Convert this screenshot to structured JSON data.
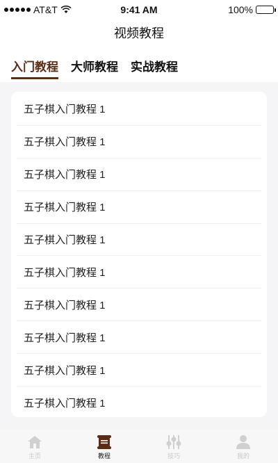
{
  "status_bar": {
    "carrier": "AT&T",
    "time": "9:41 AM",
    "battery": "100%"
  },
  "nav": {
    "title": "视频教程"
  },
  "tabs": [
    {
      "label": "入门教程",
      "active": true
    },
    {
      "label": "大师教程",
      "active": false
    },
    {
      "label": "实战教程",
      "active": false
    }
  ],
  "list": {
    "items": [
      "五子棋入门教程 1",
      "五子棋入门教程 1",
      "五子棋入门教程 1",
      "五子棋入门教程 1",
      "五子棋入门教程 1",
      "五子棋入门教程 1",
      "五子棋入门教程 1",
      "五子棋入门教程 1",
      "五子棋入门教程 1",
      "五子棋入门教程 1"
    ]
  },
  "tab_bar": {
    "items": [
      {
        "label": "主页",
        "icon": "home-icon",
        "active": false
      },
      {
        "label": "教程",
        "icon": "scroll-icon",
        "active": true
      },
      {
        "label": "技巧",
        "icon": "sliders-icon",
        "active": false
      },
      {
        "label": "我的",
        "icon": "user-icon",
        "active": false
      }
    ]
  },
  "colors": {
    "accent": "#5b2d17",
    "inactive_icon": "#d0d0d0",
    "background": "#f5f5f7"
  }
}
